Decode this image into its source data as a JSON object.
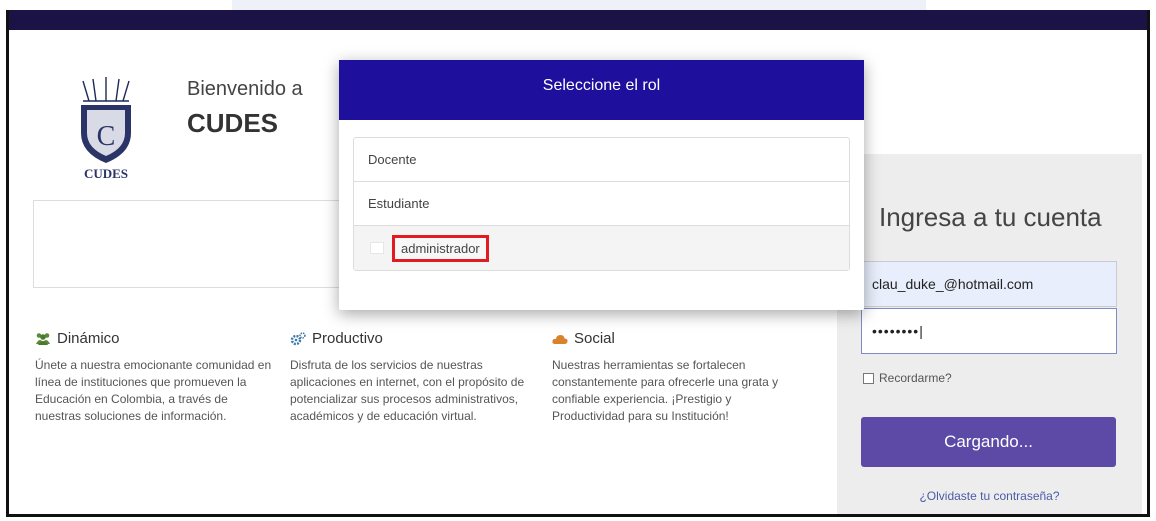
{
  "header": {
    "welcome": "Bienvenido a",
    "brand": "CUDES",
    "logo_text": "CUDES"
  },
  "features": [
    {
      "icon": "users-icon",
      "title": "Dinámico",
      "text": "Únete a nuestra emocionante comunidad en línea de instituciones que promueven la Educación en Colombia, a través de nuestras soluciones de información."
    },
    {
      "icon": "cogs-icon",
      "title": "Productivo",
      "text": "Disfruta de los servicios de nuestras aplicaciones en internet, con el propósito de potencializar sus procesos administrativos, académicos y de educación virtual."
    },
    {
      "icon": "cloud-icon",
      "title": "Social",
      "text": "Nuestras herramientas se fortalecen constantemente para ofrecerle una grata y confiable experiencia. ¡Prestigio y Productividad para su Institución!"
    }
  ],
  "login": {
    "title": "Ingresa a tu cuenta",
    "email_value": "clau_duke_@hotmail.com",
    "password_mask": "••••••••|",
    "remember_label": "Recordarme?",
    "button_label": "Cargando...",
    "forgot_label": "¿Olvidaste tu contraseña?"
  },
  "modal": {
    "title": "Seleccione el rol",
    "roles": [
      "Docente",
      "Estudiante",
      "administrador"
    ]
  },
  "colors": {
    "topbar": "#1b1245",
    "modal_header": "#1e0f9c",
    "button": "#5c4aa6",
    "highlight": "#e21b23"
  }
}
